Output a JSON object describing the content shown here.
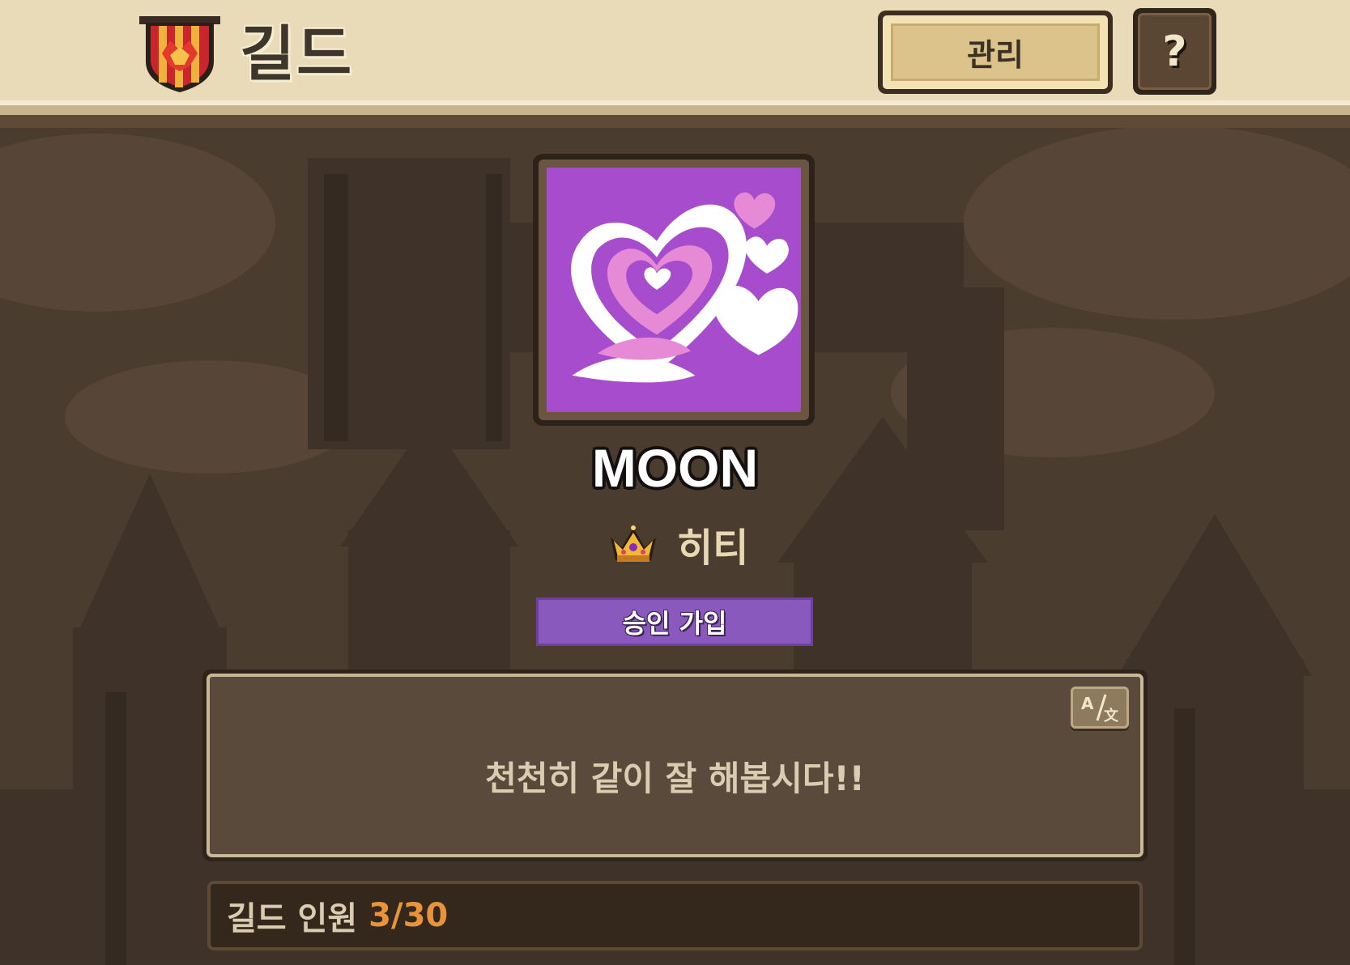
{
  "header": {
    "title": "길드",
    "emblem_icon": "guild-shield-icon",
    "manage_label": "관리",
    "help_label": "?"
  },
  "guild": {
    "icon": "heart-emblem-icon",
    "icon_bg_color": "#a64ccc",
    "name": "MOON",
    "leader_icon": "crown-icon",
    "leader_name": "히티",
    "join_type": "승인 가입",
    "description": "천천히 같이 잘 해봅시다!!",
    "translate_icon": "translate-icon",
    "member_label": "길드 인원",
    "member_count": "3/30"
  },
  "colors": {
    "header_bg": "#e9dbb7",
    "join_badge": "#8a59bd",
    "member_count": "#e9933a"
  }
}
